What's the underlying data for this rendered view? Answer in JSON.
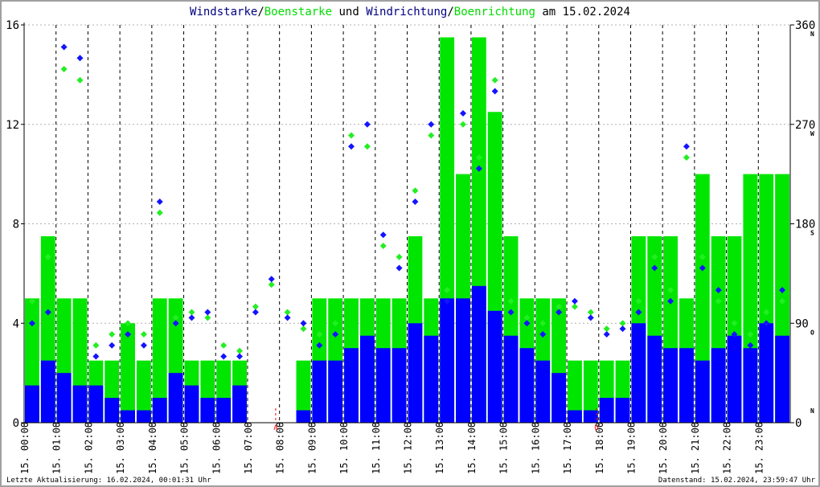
{
  "chart_data": {
    "type": "bar",
    "title_parts": {
      "wind": "Windstarke",
      "sep1": "/",
      "gust": "Boenstarke",
      "und": " und ",
      "dir": "Windrichtung",
      "sep2": "/",
      "gustdir": "Boenrichtung",
      "date": " am 15.02.2024"
    },
    "left_axis": {
      "ylim": [
        0,
        16
      ],
      "ticks": [
        "0",
        "4",
        "8",
        "12",
        "16"
      ]
    },
    "right_axis": {
      "ylim": [
        0,
        360
      ],
      "ticks": [
        "0",
        "90",
        "180",
        "270",
        "360"
      ],
      "compass": [
        "N",
        "O",
        "S",
        "W",
        "N"
      ]
    },
    "x_tick_labels": [
      "15. 00:00",
      "15. 01:00",
      "15. 02:00",
      "15. 03:00",
      "15. 04:00",
      "15. 05:00",
      "15. 06:00",
      "15. 07:00",
      "15. 08:00",
      "15. 09:00",
      "15. 10:00",
      "15. 11:00",
      "15. 12:00",
      "15. 13:00",
      "15. 14:00",
      "15. 15:00",
      "15. 16:00",
      "15. 17:00",
      "15. 18:00",
      "15. 19:00",
      "15. 20:00",
      "15. 21:00",
      "15. 22:00",
      "15. 23:00"
    ],
    "x_hours_start": 0,
    "x_hours_end": 24,
    "sample_interval_hours": 0.5,
    "markers": [
      {
        "label": "A",
        "hour": 7.88,
        "meaning": "Sonnenaufgang"
      },
      {
        "label": "U",
        "hour": 17.93,
        "meaning": "Sonnenuntergang"
      }
    ],
    "series": [
      {
        "name": "Windstarke",
        "kind": "bar",
        "color": "#0000ff",
        "values": [
          1.5,
          2.5,
          2,
          1.5,
          1.5,
          1,
          0.5,
          0.5,
          1,
          2,
          1.5,
          1,
          1,
          1.5,
          0,
          0,
          0,
          0.5,
          2.5,
          2.5,
          3,
          3.5,
          3,
          3,
          4,
          3.5,
          5,
          5,
          5.5,
          4.5,
          3.5,
          3,
          2.5,
          2,
          0.5,
          0.5,
          1,
          1,
          4,
          3.5,
          3,
          3,
          2.5,
          3,
          3.5,
          3,
          4,
          3.5
        ]
      },
      {
        "name": "Boenstarke",
        "kind": "bar",
        "color": "#00e600",
        "values": [
          5,
          7.5,
          5,
          5,
          2.5,
          2.5,
          4,
          2.5,
          5,
          5,
          2.5,
          2.5,
          2.5,
          2.5,
          0,
          0,
          0,
          2.5,
          5,
          5,
          5,
          5,
          5,
          5,
          7.5,
          5,
          15.5,
          10,
          15.5,
          12.5,
          7.5,
          5,
          5,
          5,
          2.5,
          2.5,
          2.5,
          2.5,
          7.5,
          7.5,
          7.5,
          5,
          10,
          7.5,
          7.5,
          10,
          10,
          10
        ]
      },
      {
        "name": "Windrichtung",
        "kind": "scatter",
        "color": "#1414ff",
        "values": [
          90,
          100,
          340,
          330,
          60,
          70,
          80,
          70,
          200,
          90,
          95,
          100,
          60,
          60,
          100,
          130,
          95,
          90,
          70,
          80,
          250,
          270,
          170,
          140,
          200,
          270,
          110,
          280,
          230,
          300,
          100,
          90,
          80,
          100,
          110,
          95,
          80,
          85,
          100,
          140,
          110,
          250,
          140,
          120,
          80,
          70,
          90,
          120
        ]
      },
      {
        "name": "Boenrichtung",
        "kind": "scatter",
        "color": "#22ee22",
        "values": [
          110,
          150,
          320,
          310,
          70,
          80,
          90,
          80,
          190,
          95,
          100,
          95,
          70,
          65,
          105,
          125,
          100,
          85,
          80,
          90,
          260,
          250,
          160,
          150,
          210,
          260,
          120,
          270,
          240,
          310,
          110,
          95,
          90,
          105,
          105,
          100,
          85,
          90,
          110,
          150,
          120,
          240,
          150,
          110,
          90,
          80,
          100,
          110
        ]
      }
    ]
  },
  "footer": {
    "last_update": "Letzte Aktualisierung: 16.02.2024, 00:01:31 Uhr",
    "data_state": "Datenstand: 15.02.2024, 23:59:47 Uhr"
  }
}
